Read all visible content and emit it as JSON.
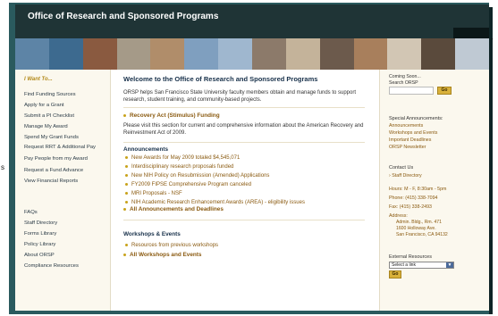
{
  "header": {
    "title": "Office of Research and Sponsored Programs"
  },
  "edge": {
    "left_char": "s",
    "right_char": "-"
  },
  "banner": {
    "colors": [
      "#5d84a6",
      "#3d6a8f",
      "#8a5a40",
      "#a59a88",
      "#b08d6a",
      "#7f9fbf",
      "#9fb7cf",
      "#8c7a6a",
      "#c4b39a",
      "#6c5a4c",
      "#a87f5c",
      "#d2c6b4",
      "#5a4a3c",
      "#bfc9d3"
    ]
  },
  "left_nav": {
    "heading": "I Want To...",
    "items": [
      "Find Funding Sources",
      "Apply for a Grant",
      "Submit a PI Checklist",
      "Manage My Award",
      "Spend My Grant Funds",
      "Request RRT & Additional Pay",
      "Pay People from my Award",
      "Request a Fund Advance",
      "View Financial Reports"
    ],
    "items2": [
      "FAQs",
      "Staff Directory",
      "Forms Library",
      "Policy Library",
      "About ORSP",
      "Compliance Resources"
    ]
  },
  "main": {
    "welcome_title": "Welcome to the Office of Research and Sponsored Programs",
    "intro": "ORSP helps San Francisco State University faculty members obtain and manage funds to support research, student training, and community-based projects.",
    "recovery_head": "Recovery Act (Stimulus) Funding",
    "recovery_text": "Please visit this section for current and comprehensive information about the American Recovery and Reinvestment Act of 2009.",
    "announcements_head": "Announcements",
    "announcements": [
      "New Awards for May 2009 totaled $4,545,071",
      "Interdisciplinary research proposals funded",
      "New NIH Policy on Resubmission (Amended) Applications",
      "FY2009 FIPSE Comprehensive Program canceled",
      "MRI Proposals - NSF",
      "NIH Academic Research Enhancement Awards (AREA) - eligibility issues"
    ],
    "all_announcements": "All Announcements and Deadlines",
    "workshops_head": "Workshops & Events",
    "workshops_item": "Resources from previous workshops",
    "all_workshops": "All Workshops and Events"
  },
  "right": {
    "coming_soon": "Coming Soon...",
    "search_label": "Search ORSP",
    "go_label": "Go",
    "special_head": "Special Announcements:",
    "special_items": [
      "Announcements",
      "Workshops and Events",
      "Important Deadlines",
      "ORSP Newsletter"
    ],
    "contact_head": "Contact Us",
    "staff_dir": "Staff Directory",
    "hours": "Hours: M - F, 8:30am - 5pm",
    "phone": "Phone: (415) 338-7094",
    "fax": "Fax: (415) 338-2493",
    "address_label": "Address:",
    "address_lines": [
      "Admin. Bldg., Rm. 471",
      "1600 Holloway Ave.",
      "San Francisco, CA 94132"
    ],
    "external_head": "External Resources",
    "select_value": "Select a link",
    "go2_label": "Go"
  }
}
